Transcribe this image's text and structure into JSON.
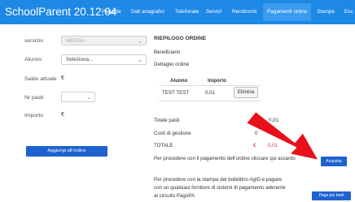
{
  "header": {
    "brand": "SchoolParent 20.12.04",
    "nav": [
      "Pagante",
      "Dati anagrafici",
      "Telefonate",
      "Servizi",
      "Rendiconti",
      "Pagamenti online",
      "Stampe",
      "Esc"
    ],
    "active_index": 5
  },
  "form": {
    "servizio_label": "servizio",
    "servizio_value": "MENSA",
    "alunno_label": "Alunno",
    "alunno_value": "Seleziona...",
    "saldo_label": "Saldo attuale",
    "saldo_value": "€",
    "npasti_label": "Nr pasti",
    "npasti_value": "",
    "importo_label": "Importo",
    "importo_value": "€",
    "add_button": "Aggiungi all'ordine"
  },
  "summary": {
    "title": "RIEPILOGO ORDINE",
    "beneficiario": "Beneficiario",
    "dettaglio": "Dettaglio ordine",
    "col_alunno": "Alunno",
    "col_importo": "Importo",
    "row_alunno": "TEST TEST",
    "row_importo": "0,01",
    "remove_button": "Elimina",
    "totale_pasti_label": "Totale pasti",
    "totale_pasti_value": "0,01",
    "costi_label": "Costi di gestione",
    "costi_value": "0",
    "totale_label": "TOTALE",
    "totale_currency": "€",
    "totale_value": "0,01",
    "procedi_text": "Per procedere con il pagamento dell'ordine cliccare qui accanto",
    "acquista_button": "Acquista",
    "bollettino_line1": "Per procedere con la stampa del bollettino AgID e pagare",
    "bollettino_line2": "con un qualsiasi fornitore di sistemi di pagamento aderente",
    "bollettino_line3": "al circuito PagoPA",
    "paga_button": "Paga poi tardi"
  },
  "colors": {
    "topbar": "#1e88e5",
    "button": "#1e62d0",
    "arrow": "#e8101a",
    "total_red": "#c0392b"
  }
}
